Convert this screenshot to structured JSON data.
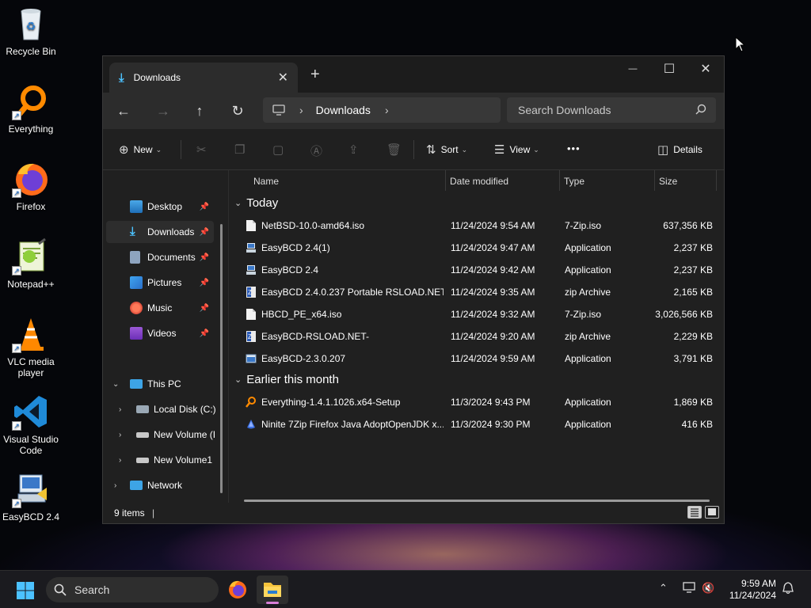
{
  "desktop": {
    "icons": [
      {
        "label": "Recycle Bin",
        "icon": "recycle-bin-icon"
      },
      {
        "label": "Everything",
        "icon": "everything-search-icon"
      },
      {
        "label": "Firefox",
        "icon": "firefox-icon"
      },
      {
        "label": "Notepad++",
        "icon": "notepad-plus-plus-icon"
      },
      {
        "label": "VLC media player",
        "icon": "vlc-cone-icon"
      },
      {
        "label": "Visual Studio Code",
        "icon": "vscode-icon"
      },
      {
        "label": "EasyBCD 2.4",
        "icon": "easybcd-icon"
      }
    ]
  },
  "window": {
    "tab_title": "Downloads",
    "tab_close": "✕",
    "new_tab": "+",
    "controls": {
      "minimize": "—",
      "maximize": "☐",
      "close": "✕"
    },
    "nav": {
      "back": "←",
      "forward": "→",
      "up": "↑",
      "refresh": "↻",
      "breadcrumb": "Downloads",
      "breadcrumb_sep": "›",
      "search_placeholder": "Search Downloads"
    },
    "commands": {
      "new_label": "New",
      "sort_label": "Sort",
      "view_label": "View",
      "more_label": "•••",
      "details_label": "Details"
    },
    "sidebar": {
      "quick_access": [
        {
          "label": "Desktop",
          "pinned": true
        },
        {
          "label": "Downloads",
          "pinned": true,
          "selected": true
        },
        {
          "label": "Documents",
          "pinned": true
        },
        {
          "label": "Pictures",
          "pinned": true
        },
        {
          "label": "Music",
          "pinned": true
        },
        {
          "label": "Videos",
          "pinned": true
        }
      ],
      "this_pc": "This PC",
      "drives": [
        "Local Disk (C:)",
        "New Volume (I",
        "New Volume1"
      ],
      "network": "Network"
    },
    "columns": {
      "name": "Name",
      "date": "Date modified",
      "type": "Type",
      "size": "Size"
    },
    "groups": [
      {
        "label": "Today",
        "files": [
          {
            "name": "NetBSD-10.0-amd64.iso",
            "date": "11/24/2024 9:54 AM",
            "type": "7-Zip.iso",
            "size": "637,356 KB",
            "icon": "file-icon"
          },
          {
            "name": "EasyBCD 2.4(1)",
            "date": "11/24/2024 9:47 AM",
            "type": "Application",
            "size": "2,237 KB",
            "icon": "installer-icon"
          },
          {
            "name": "EasyBCD 2.4",
            "date": "11/24/2024 9:42 AM",
            "type": "Application",
            "size": "2,237 KB",
            "icon": "installer-icon"
          },
          {
            "name": "EasyBCD 2.4.0.237 Portable RSLOAD.NET",
            "date": "11/24/2024 9:35 AM",
            "type": "zip Archive",
            "size": "2,165 KB",
            "icon": "zip-icon"
          },
          {
            "name": "HBCD_PE_x64.iso",
            "date": "11/24/2024 9:32 AM",
            "type": "7-Zip.iso",
            "size": "3,026,566 KB",
            "icon": "file-icon"
          },
          {
            "name": "EasyBCD-RSLOAD.NET-",
            "date": "11/24/2024 9:20 AM",
            "type": "zip Archive",
            "size": "2,229 KB",
            "icon": "zip-icon"
          },
          {
            "name": "EasyBCD-2.3.0.207",
            "date": "11/24/2024 9:59 AM",
            "type": "Application",
            "size": "3,791 KB",
            "icon": "app-window-icon"
          }
        ]
      },
      {
        "label": "Earlier this month",
        "files": [
          {
            "name": "Everything-1.4.1.1026.x64-Setup",
            "date": "11/3/2024 9:43 PM",
            "type": "Application",
            "size": "1,869 KB",
            "icon": "everything-search-icon"
          },
          {
            "name": "Ninite 7Zip Firefox Java AdoptOpenJDK x...",
            "date": "11/3/2024 9:30 PM",
            "type": "Application",
            "size": "416 KB",
            "icon": "ninite-icon"
          }
        ]
      }
    ],
    "status": {
      "count": "9 items"
    }
  },
  "taskbar": {
    "search_label": "Search",
    "apps": [
      "firefox-icon",
      "file-explorer-icon"
    ],
    "time": "9:59 AM",
    "date": "11/24/2024"
  },
  "colors": {
    "accent": "#4cc2ff",
    "folder": "#f5c33b",
    "window_bg": "#202020",
    "selected_bg": "#2d2d2d"
  }
}
